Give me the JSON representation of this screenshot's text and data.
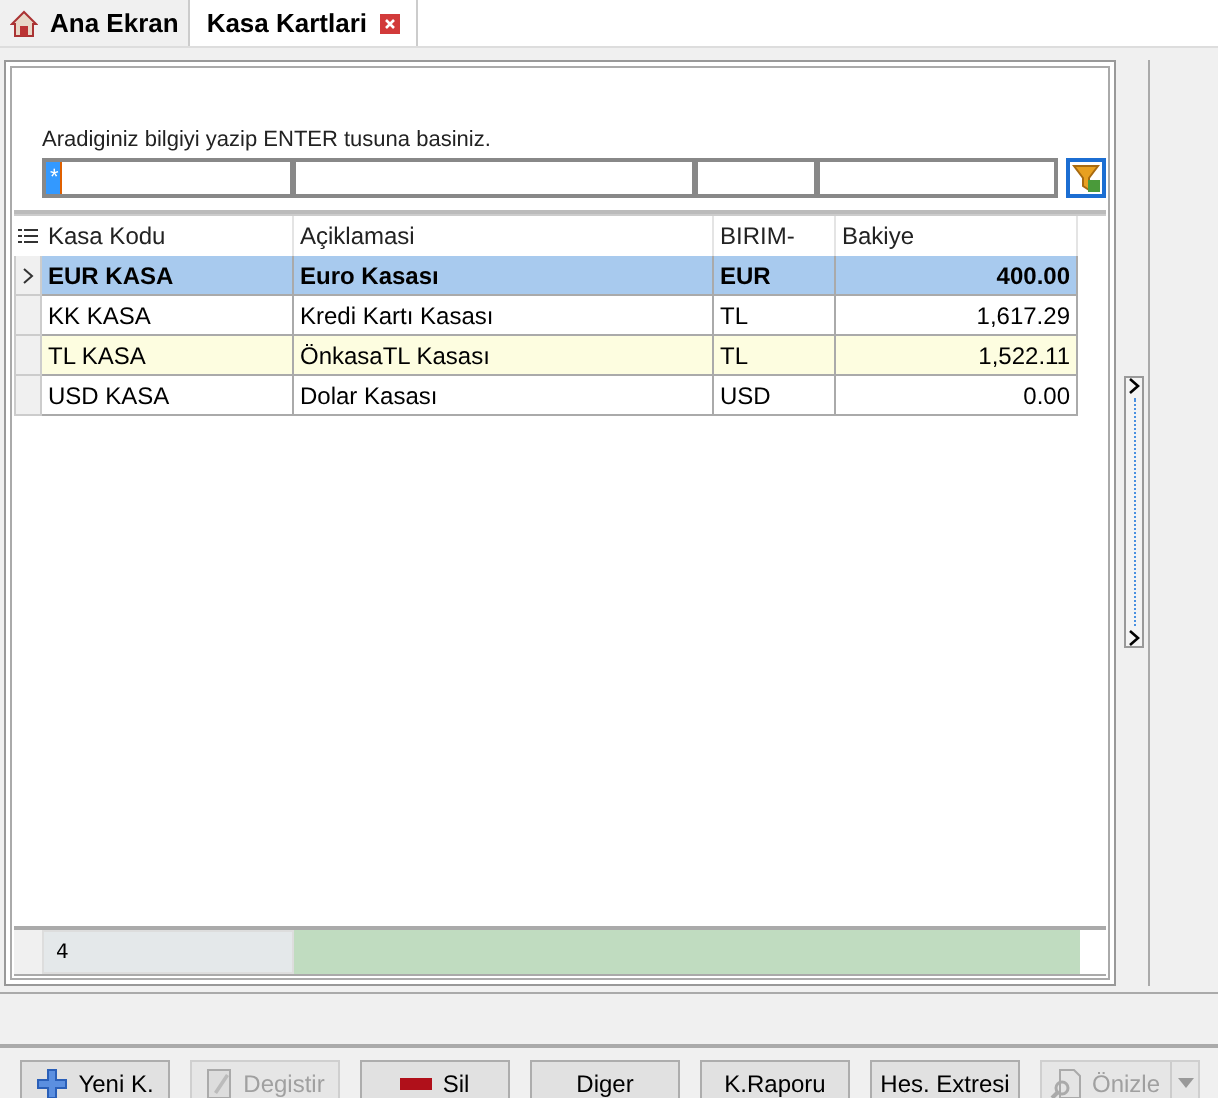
{
  "tabs": [
    {
      "label": "Ana Ekran",
      "selected": false,
      "kind": "home"
    },
    {
      "label": "Kasa Kartlari",
      "selected": true,
      "kind": "closable"
    }
  ],
  "search": {
    "hint": "Aradiginiz bilgiyi yazip ENTER tusuna basiniz.",
    "filter_value": "*"
  },
  "table": {
    "columns": [
      "Kasa Kodu",
      "Açiklamasi",
      "BIRIM-",
      "Bakiye"
    ],
    "rows": [
      {
        "cells": [
          "EUR KASA",
          "Euro Kasası",
          "EUR",
          "400.00"
        ],
        "selected": true,
        "highlighted": false
      },
      {
        "cells": [
          "KK KASA",
          "Kredi Kartı Kasası",
          "TL",
          "1,617.29"
        ],
        "selected": false,
        "highlighted": false
      },
      {
        "cells": [
          "TL KASA",
          "ÖnkasaTL Kasası",
          "TL",
          "1,522.11"
        ],
        "selected": false,
        "highlighted": true
      },
      {
        "cells": [
          "USD KASA",
          "Dolar Kasası",
          "USD",
          "0.00"
        ],
        "selected": false,
        "highlighted": false
      }
    ],
    "footer_count": "4"
  },
  "buttons": [
    {
      "label": "Yeni K.",
      "kind": "add",
      "disabled": false
    },
    {
      "label": "Degistir",
      "kind": "edit",
      "disabled": true
    },
    {
      "label": "Sil",
      "kind": "delete",
      "disabled": false
    },
    {
      "label": "Diger",
      "kind": "plain",
      "disabled": false
    },
    {
      "label": "K.Raporu",
      "kind": "plain",
      "disabled": false
    },
    {
      "label": "Hes. Extresi",
      "kind": "plain",
      "disabled": false
    },
    {
      "label": "Önizle",
      "kind": "preview-split",
      "disabled": true
    }
  ]
}
